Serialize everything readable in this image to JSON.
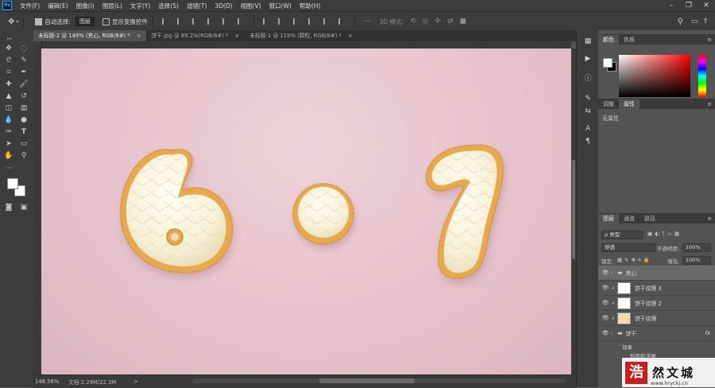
{
  "app": {
    "logo": "Ps"
  },
  "menu": [
    "文件(F)",
    "编辑(E)",
    "图像(I)",
    "图层(L)",
    "文字(Y)",
    "选择(S)",
    "滤镜(T)",
    "3D(D)",
    "视图(V)",
    "窗口(W)",
    "帮助(H)"
  ],
  "options": {
    "auto_select_label": "自动选择:",
    "auto_select_value": "图层",
    "show_transform_label": "显示变换控件",
    "mode_3d_label": "3D 模式:"
  },
  "tabs": [
    {
      "label": "未标题-2 @ 149% (夹心, RGB/8#) *",
      "close": "×"
    },
    {
      "label": "饼干.jpg @ 89.2%(RGB/8#) *",
      "close": "×"
    },
    {
      "label": "未标题-1 @ 119% (颗粒, RGB/8#) *",
      "close": "×"
    }
  ],
  "status": {
    "zoom": "148.56%",
    "doc": "文档:2.29M/22.3M",
    "arrow": ">"
  },
  "panels": {
    "color_tabs": [
      "颜色",
      "色板"
    ],
    "props_tabs": [
      "调整",
      "属性"
    ],
    "props_empty": "无属性",
    "layers_tabs": [
      "图层",
      "通道",
      "路径"
    ],
    "filter_kind": "ρ 类型",
    "blend_mode": "穿透",
    "opacity_label": "不透明度:",
    "opacity_value": "100%",
    "lock_label": "锁定:",
    "fill_label": "填充:",
    "fill_value": "100%",
    "layers": [
      {
        "name": "夹心",
        "type": "group"
      },
      {
        "name": "饼干纹理 3",
        "type": "layer"
      },
      {
        "name": "饼干纹理 2",
        "type": "layer"
      },
      {
        "name": "饼干纹理",
        "type": "layer"
      },
      {
        "name": "饼干",
        "type": "group",
        "fx": "fx"
      }
    ],
    "effects_label": "效果",
    "effect_item": "斜面和浮雕"
  },
  "watermark": {
    "seal": "浩",
    "name": "然文城",
    "url": "www.hryckj.cn"
  },
  "colors": {
    "bg_canvas": "#e6c3cc",
    "panel": "#535353",
    "chrome": "#3c3c3c",
    "icing": "#fffbe8",
    "biscuit": "#e8b464"
  }
}
